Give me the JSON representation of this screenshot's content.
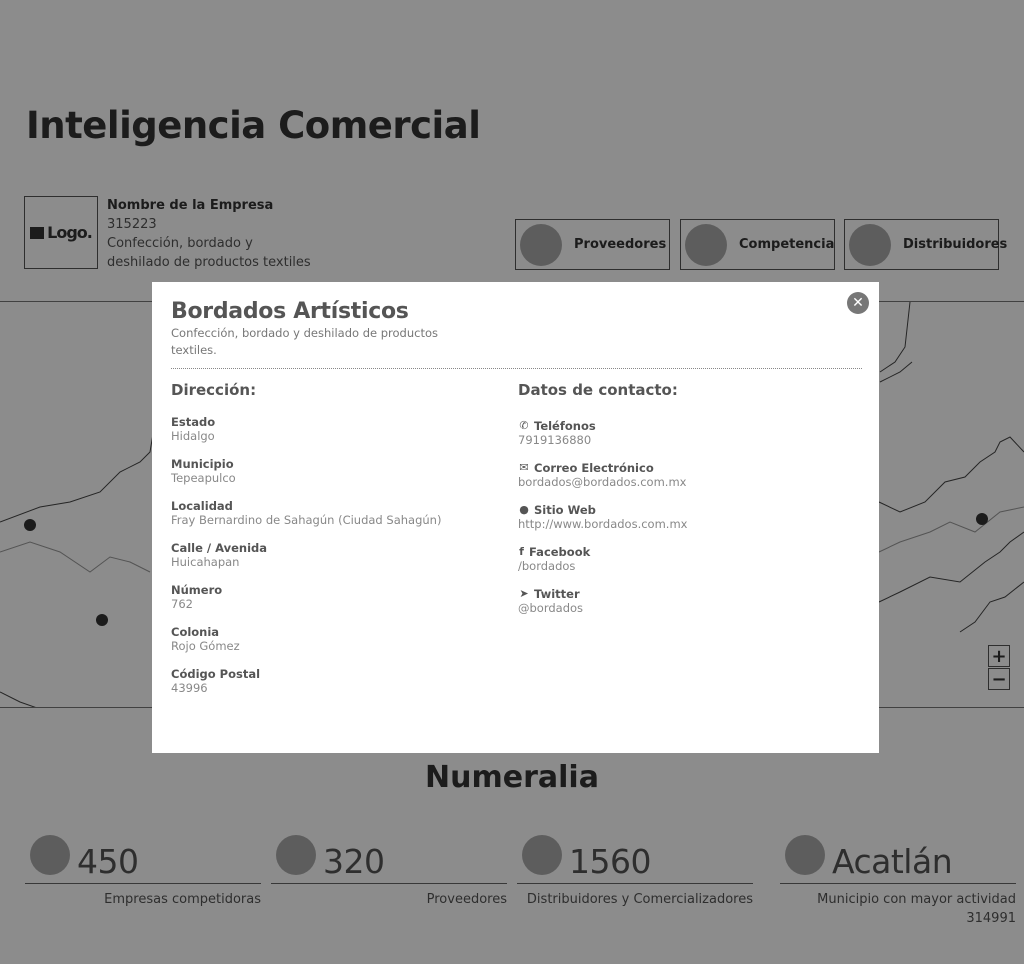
{
  "header": {
    "title": "Inteligencia Comercial"
  },
  "company": {
    "logo_text": "Logo.",
    "name_label": "Nombre de la Empresa",
    "code": "315223",
    "description": "Confección, bordado y deshilado de productos textiles"
  },
  "nav": {
    "proveedores": "Proveedores",
    "competencia": "Competencia",
    "distribuidores": "Distribuidores"
  },
  "map": {
    "zoom_in": "+",
    "zoom_out": "−"
  },
  "numeralia": {
    "title": "Numeralia",
    "stats": [
      {
        "value": "450",
        "label": "Empresas competidoras"
      },
      {
        "value": "320",
        "label": "Proveedores"
      },
      {
        "value": "1560",
        "label": "Distribuidores y Comercializadores"
      },
      {
        "value": "Acatlán",
        "label": "Municipio con mayor actividad",
        "sub": "314991"
      }
    ]
  },
  "modal": {
    "close_icon": "close-icon",
    "title": "Bordados Artísticos",
    "subtitle": "Confección, bordado y deshilado de productos textiles.",
    "address_heading": "Dirección:",
    "contact_heading": "Datos de contacto:",
    "address": [
      {
        "label": "Estado",
        "value": "Hidalgo"
      },
      {
        "label": "Municipio",
        "value": "Tepeapulco"
      },
      {
        "label": "Localidad",
        "value": "Fray Bernardino de Sahagún (Ciudad Sahagún)"
      },
      {
        "label": "Calle / Avenida",
        "value": "Huicahapan"
      },
      {
        "label": "Número",
        "value": "762"
      },
      {
        "label": "Colonia",
        "value": "Rojo Gómez"
      },
      {
        "label": "Código Postal",
        "value": "43996"
      }
    ],
    "contact": [
      {
        "icon": "phone-icon",
        "label": "Teléfonos",
        "value": "7919136880"
      },
      {
        "icon": "envelope-icon",
        "label": "Correo Electrónico",
        "value": "bordados@bordados.com.mx"
      },
      {
        "icon": "globe-icon",
        "label": "Sitio Web",
        "value": "http://www.bordados.com.mx"
      },
      {
        "icon": "facebook-icon",
        "label": "Facebook",
        "value": "/bordados"
      },
      {
        "icon": "twitter-icon",
        "label": "Twitter",
        "value": "@bordados"
      }
    ]
  }
}
